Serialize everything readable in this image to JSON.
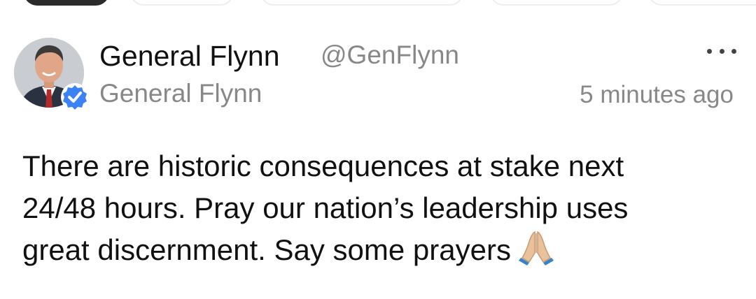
{
  "post": {
    "author_name": "General Flynn",
    "author_handle": "@GenFlynn",
    "display_name": "General Flynn",
    "timestamp": "5 minutes ago",
    "body_lines": [
      "There are historic consequences at stake next",
      "24/48 hours. Pray our nation’s leadership uses",
      "great discernment. Say some prayers"
    ],
    "verified": true
  },
  "icons": {
    "avatar": "avatar-photo",
    "verified": "verified-badge-icon",
    "more": "more-options-icon",
    "emoji": "folded-hands-emoji"
  },
  "colors": {
    "text_primary": "#111111",
    "text_secondary": "#888888",
    "verified_blue": "#3b82f6"
  }
}
